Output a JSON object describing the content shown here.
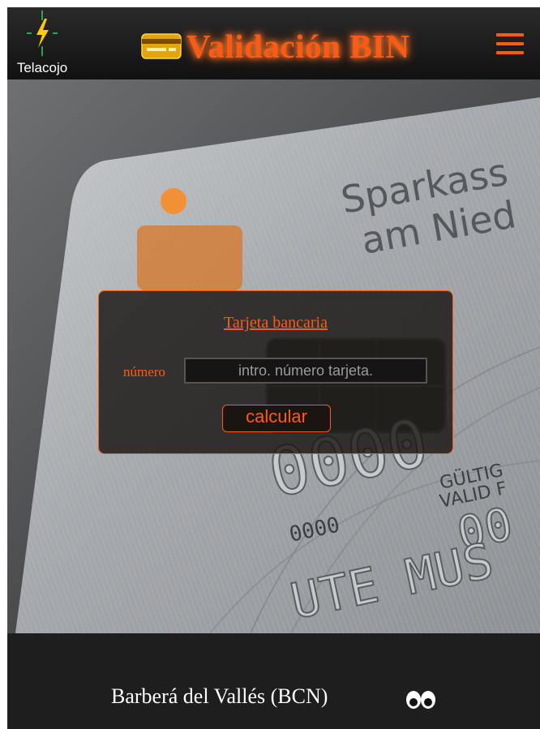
{
  "header": {
    "logo_text": "Telacojo",
    "title": "Validación BIN",
    "icons": {
      "logo": "lightning-logo-icon",
      "card": "credit-card-icon",
      "menu": "hamburger-menu-icon"
    },
    "accent_color": "#ff5a14"
  },
  "hero": {
    "card_print": {
      "bank_line_1": "Sparkass",
      "bank_line_2": "am Nied",
      "number_big": "0000",
      "number_small": "0000",
      "valid_1": "GÜLTIG",
      "valid_2": "VALID F",
      "valid_date": "00",
      "holder": "UTE MUS"
    }
  },
  "form": {
    "title": "Tarjeta bancaria",
    "field_label": "número",
    "field_placeholder": "intro. número tarjeta.",
    "field_value": "",
    "button_label": "calcular"
  },
  "footer": {
    "location": "Barberá del Vallés (BCN)",
    "icon": "eyes-icon"
  }
}
